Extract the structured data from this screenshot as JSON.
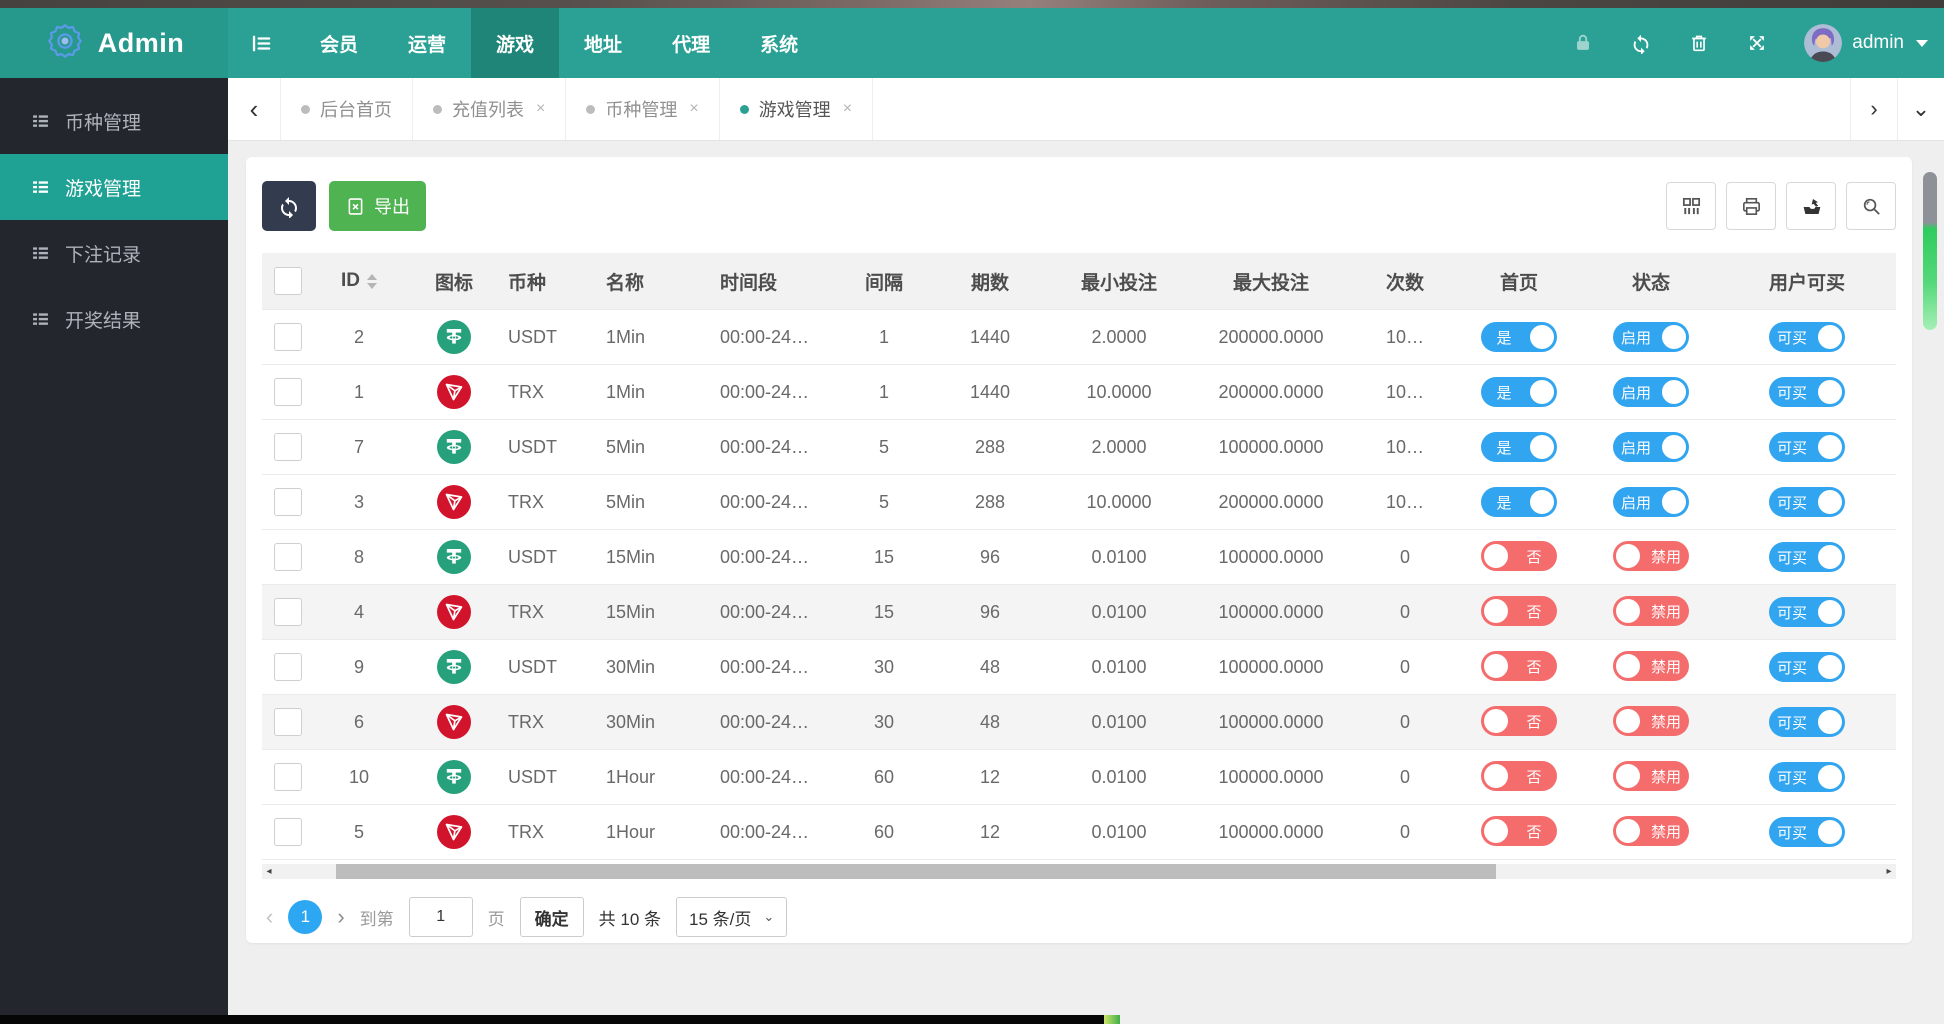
{
  "header": {
    "brand": "Admin",
    "nav": [
      {
        "label": "会员",
        "active": false
      },
      {
        "label": "运营",
        "active": false
      },
      {
        "label": "游戏",
        "active": true
      },
      {
        "label": "地址",
        "active": false
      },
      {
        "label": "代理",
        "active": false
      },
      {
        "label": "系统",
        "active": false
      }
    ],
    "right": {
      "icons": [
        "lock-icon",
        "refresh-icon",
        "trash-icon",
        "fullscreen-icon"
      ],
      "user": "admin"
    }
  },
  "sidebar": {
    "items": [
      {
        "label": "币种管理",
        "active": false
      },
      {
        "label": "游戏管理",
        "active": true
      },
      {
        "label": "下注记录",
        "active": false
      },
      {
        "label": "开奖结果",
        "active": false
      }
    ]
  },
  "tabs": [
    {
      "label": "后台首页",
      "closable": false,
      "active": false
    },
    {
      "label": "充值列表",
      "closable": true,
      "active": false
    },
    {
      "label": "币种管理",
      "closable": true,
      "active": false
    },
    {
      "label": "游戏管理",
      "closable": true,
      "active": true
    }
  ],
  "toolbar": {
    "export_label": "导出",
    "right_icons": [
      "columns-icon",
      "print-icon",
      "export-icon",
      "search-icon"
    ]
  },
  "table": {
    "columns": [
      {
        "key": "checkbox",
        "label": ""
      },
      {
        "key": "id",
        "label": "ID",
        "sortable": true
      },
      {
        "key": "icon",
        "label": "图标"
      },
      {
        "key": "coin",
        "label": "币种"
      },
      {
        "key": "name",
        "label": "名称"
      },
      {
        "key": "time",
        "label": "时间段"
      },
      {
        "key": "interval",
        "label": "间隔"
      },
      {
        "key": "issues",
        "label": "期数"
      },
      {
        "key": "min",
        "label": "最小投注"
      },
      {
        "key": "max",
        "label": "最大投注"
      },
      {
        "key": "times",
        "label": "次数"
      },
      {
        "key": "home",
        "label": "首页"
      },
      {
        "key": "status",
        "label": "状态"
      },
      {
        "key": "buy",
        "label": "用户可买"
      }
    ],
    "toggle_labels": {
      "home_on": "是",
      "home_off": "否",
      "status_on": "启用",
      "status_off": "禁用",
      "buy_on": "可买"
    },
    "rows": [
      {
        "id": "2",
        "coin": "USDT",
        "name": "1Min",
        "time": "00:00-24…",
        "interval": "1",
        "issues": "1440",
        "min": "2.0000",
        "max": "200000.0000",
        "times": "10…",
        "home": true,
        "status": true,
        "buy": true,
        "striped": false
      },
      {
        "id": "1",
        "coin": "TRX",
        "name": "1Min",
        "time": "00:00-24…",
        "interval": "1",
        "issues": "1440",
        "min": "10.0000",
        "max": "200000.0000",
        "times": "10…",
        "home": true,
        "status": true,
        "buy": true,
        "striped": false
      },
      {
        "id": "7",
        "coin": "USDT",
        "name": "5Min",
        "time": "00:00-24…",
        "interval": "5",
        "issues": "288",
        "min": "2.0000",
        "max": "100000.0000",
        "times": "10…",
        "home": true,
        "status": true,
        "buy": true,
        "striped": false
      },
      {
        "id": "3",
        "coin": "TRX",
        "name": "5Min",
        "time": "00:00-24…",
        "interval": "5",
        "issues": "288",
        "min": "10.0000",
        "max": "200000.0000",
        "times": "10…",
        "home": true,
        "status": true,
        "buy": true,
        "striped": false
      },
      {
        "id": "8",
        "coin": "USDT",
        "name": "15Min",
        "time": "00:00-24…",
        "interval": "15",
        "issues": "96",
        "min": "0.0100",
        "max": "100000.0000",
        "times": "0",
        "home": false,
        "status": false,
        "buy": true,
        "striped": false
      },
      {
        "id": "4",
        "coin": "TRX",
        "name": "15Min",
        "time": "00:00-24…",
        "interval": "15",
        "issues": "96",
        "min": "0.0100",
        "max": "100000.0000",
        "times": "0",
        "home": false,
        "status": false,
        "buy": true,
        "striped": true
      },
      {
        "id": "9",
        "coin": "USDT",
        "name": "30Min",
        "time": "00:00-24…",
        "interval": "30",
        "issues": "48",
        "min": "0.0100",
        "max": "100000.0000",
        "times": "0",
        "home": false,
        "status": false,
        "buy": true,
        "striped": false
      },
      {
        "id": "6",
        "coin": "TRX",
        "name": "30Min",
        "time": "00:00-24…",
        "interval": "30",
        "issues": "48",
        "min": "0.0100",
        "max": "100000.0000",
        "times": "0",
        "home": false,
        "status": false,
        "buy": true,
        "striped": true
      },
      {
        "id": "10",
        "coin": "USDT",
        "name": "1Hour",
        "time": "00:00-24…",
        "interval": "60",
        "issues": "12",
        "min": "0.0100",
        "max": "100000.0000",
        "times": "0",
        "home": false,
        "status": false,
        "buy": true,
        "striped": false
      },
      {
        "id": "5",
        "coin": "TRX",
        "name": "1Hour",
        "time": "00:00-24…",
        "interval": "60",
        "issues": "12",
        "min": "0.0100",
        "max": "100000.0000",
        "times": "0",
        "home": false,
        "status": false,
        "buy": true,
        "striped": false
      }
    ]
  },
  "pagination": {
    "current_page": "1",
    "goto_label": "到第",
    "input_value": "1",
    "page_unit": "页",
    "confirm_label": "确定",
    "total_label": "共 10 条",
    "page_size_label": "15 条/页"
  },
  "colors": {
    "primary_teal": "#2aa194",
    "nav_active_teal": "#1e8578",
    "sidebar_dark": "#23262d",
    "toggle_blue": "#32a5f1",
    "toggle_red": "#f56c6c",
    "export_green": "#50b351",
    "dark_button": "#333b4e",
    "usdt_green": "#26a17b",
    "trx_red": "#d1142c",
    "pagination_blue": "#2ea7f3"
  }
}
